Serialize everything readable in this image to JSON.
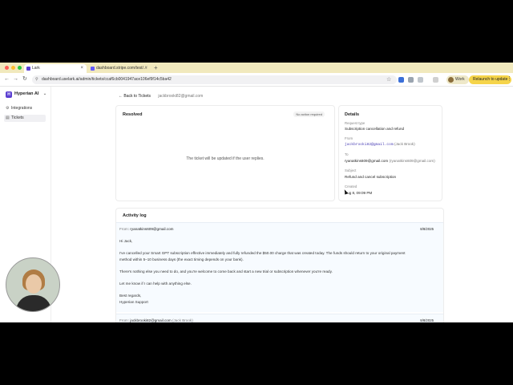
{
  "browser": {
    "tabs": [
      {
        "label": "Lark",
        "active": true
      },
      {
        "label": "dashboard.stripe.com/test/...",
        "active": false
      }
    ],
    "url": "dashboard.uselark.ai/admin/tickets/ccaf6cb0041947ace106ef9f14c5ba42",
    "profile_label": "Work",
    "relaunch_label": "Relaunch to update"
  },
  "sidebar": {
    "workspace": "Hyperian AI",
    "items": [
      {
        "label": "Integrations",
        "icon": "plug-icon"
      },
      {
        "label": "Tickets",
        "icon": "ticket-icon"
      }
    ]
  },
  "ticket": {
    "back_label": "Back to Tickets",
    "customer_email": "jackbrooki82@gmail.com",
    "status_title": "Resolved",
    "status_badge": "No action required",
    "reply_message": "The ticket will be updated if the user replies."
  },
  "details": {
    "title": "Details",
    "request_type_label": "Request type",
    "request_type": "Subscription cancellation and refund",
    "from_label": "From",
    "from_email": "jackbrooki82@gmail.com",
    "from_name": "(Jack Brook)",
    "to_label": "To",
    "to_email": "ryanatkins609@gmail.com",
    "to_name": "(ryanatkins609@gmail.com)",
    "subject_label": "Subject",
    "subject": "Refund and cancel subscription",
    "created_label": "Created",
    "created": "Aug 8, 09:09 PM"
  },
  "activity": {
    "title": "Activity log",
    "messages": [
      {
        "from_label": "From:",
        "from": "ryanatkins609@gmail.com",
        "date": "8/8/2025",
        "lines": [
          "Hi Jack,",
          "I've cancelled your Smart GPT subscription effective immediately and fully refunded the $50.00 charge that was created today.  The funds should return to your original payment",
          "method within 5–10 business days (the exact timing depends on your bank).",
          "There's nothing else you need to do, and you're welcome to come back and start a new trial or subscription whenever you're ready.",
          "Let me know if I can help with anything else.",
          "Best regards,",
          "Hyperian Support"
        ]
      },
      {
        "from_label": "From:",
        "from": "jackbrooki82@gmail.com",
        "from_name": "(Jack Brook)",
        "date": "8/8/2025"
      }
    ]
  },
  "colors": {
    "tab_strip": "#f1e9bd",
    "brand": "#5b3fd1",
    "relaunch": "#f5d44a",
    "message_bg": "#f7fbff"
  }
}
